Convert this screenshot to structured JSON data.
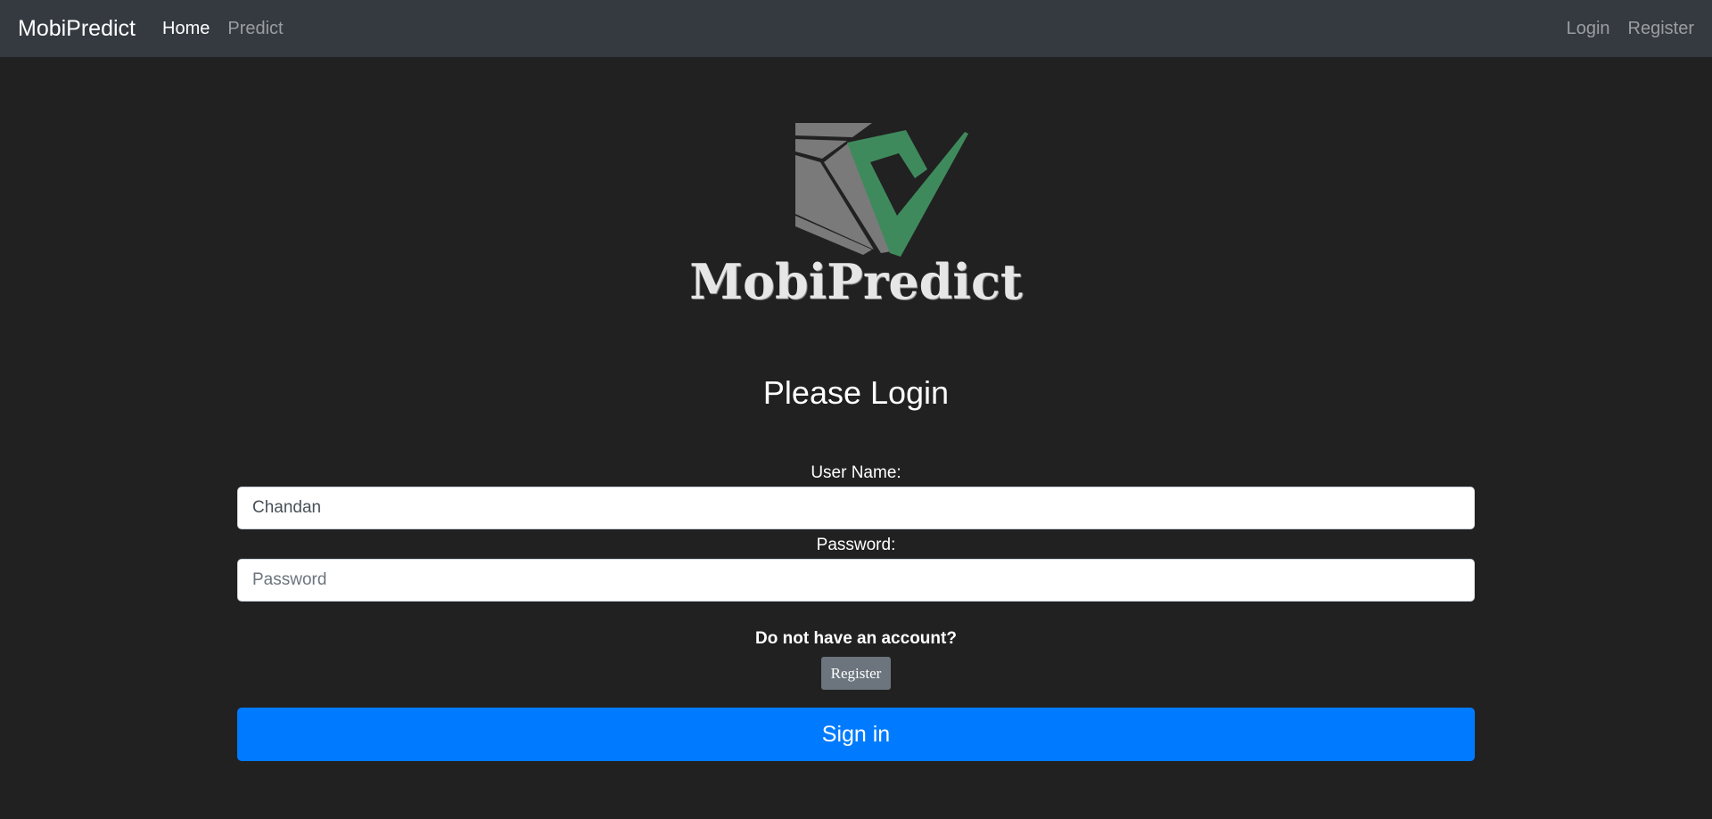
{
  "navbar": {
    "brand": "MobiPredict",
    "links": [
      {
        "label": "Home",
        "active": true
      },
      {
        "label": "Predict",
        "active": false
      }
    ],
    "right_links": [
      {
        "label": "Login"
      },
      {
        "label": "Register"
      }
    ],
    "background": "#343a40"
  },
  "logo": {
    "text": "MobiPredict",
    "icon": "checkmark-document-logo",
    "colors": {
      "gray": "#7a7a7a",
      "green": "#3f8a5c"
    }
  },
  "heading": "Please Login",
  "form": {
    "username_label": "User Name:",
    "username_value": "Chandan",
    "password_label": "Password:",
    "password_placeholder": "Password",
    "no_account_text": "Do not have an account?",
    "register_label": "Register",
    "signin_label": "Sign in"
  },
  "colors": {
    "page_bg": "#212121",
    "primary": "#007bff",
    "secondary": "#6c757d"
  }
}
